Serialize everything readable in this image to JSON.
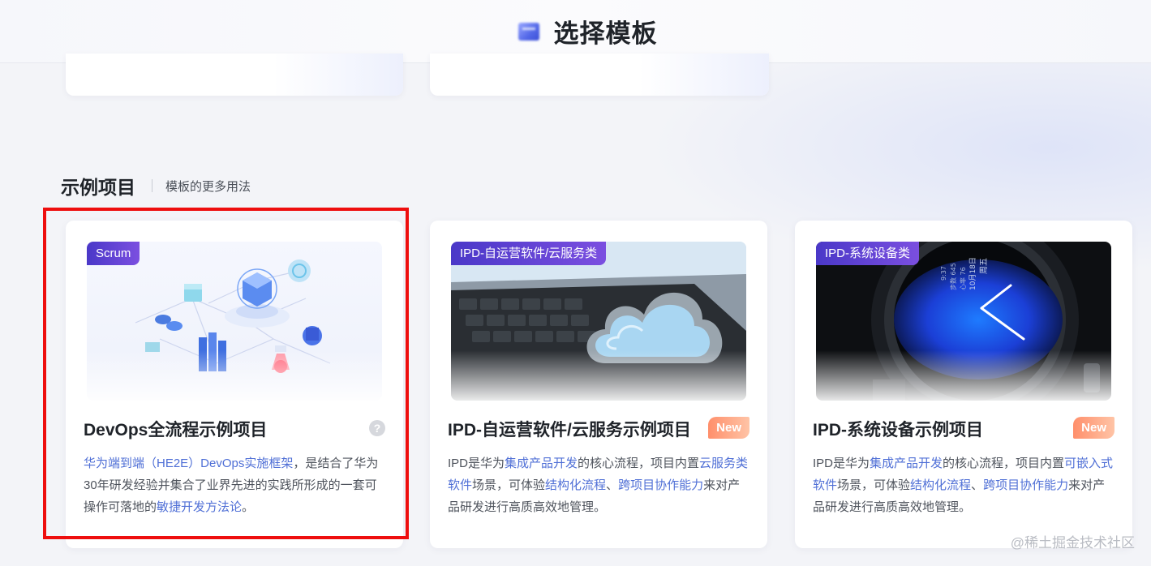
{
  "header": {
    "title": "选择模板",
    "icon": "template-icon"
  },
  "section": {
    "title": "示例项目",
    "subtitle": "模板的更多用法"
  },
  "cards": [
    {
      "tag": "Scrum",
      "title": "DevOps全流程示例项目",
      "badge": "",
      "desc": [
        {
          "text": "华为端到端（HE2E）DevOps实施框架",
          "link": true
        },
        {
          "text": "，是结合了华为30年研发经验并集合了业界先进的实践所形成的一套可操作可落地的",
          "link": false
        },
        {
          "text": "敏捷开发方法论",
          "link": true
        },
        {
          "text": "。",
          "link": false
        }
      ]
    },
    {
      "tag": "IPD-自运营软件/云服务类",
      "title": "IPD-自运营软件/云服务示例项目",
      "badge": "New",
      "desc": [
        {
          "text": "IPD是华为",
          "link": false
        },
        {
          "text": "集成产品开发",
          "link": true
        },
        {
          "text": "的核心流程，项目内置",
          "link": false
        },
        {
          "text": "云服务类软件",
          "link": true
        },
        {
          "text": "场景，可体验",
          "link": false
        },
        {
          "text": "结构化流程",
          "link": true
        },
        {
          "text": "、",
          "link": false
        },
        {
          "text": "跨项目协作能力",
          "link": true
        },
        {
          "text": "来对产品研发进行高质高效地管理。",
          "link": false
        }
      ]
    },
    {
      "tag": "IPD-系统设备类",
      "title": "IPD-系统设备示例项目",
      "badge": "New",
      "desc": [
        {
          "text": "IPD是华为",
          "link": false
        },
        {
          "text": "集成产品开发",
          "link": true
        },
        {
          "text": "的核心流程，项目内置",
          "link": false
        },
        {
          "text": "可嵌入式软件",
          "link": true
        },
        {
          "text": "场景，可体验",
          "link": false
        },
        {
          "text": "结构化流程",
          "link": true
        },
        {
          "text": "、",
          "link": false
        },
        {
          "text": "跨项目协作能力",
          "link": true
        },
        {
          "text": "来对产品研发进行高质高效地管理。",
          "link": false
        }
      ]
    }
  ],
  "watch_face": {
    "lines": [
      "周五",
      "10月18日",
      "心率 76",
      "步数 645",
      "9:37"
    ]
  },
  "watermark": "@稀土掘金技术社区",
  "colors": {
    "link": "#4f6fd6",
    "highlight": "#ee0e0e",
    "tag": "#5b3fd4",
    "new_badge": "#ff9a78"
  }
}
